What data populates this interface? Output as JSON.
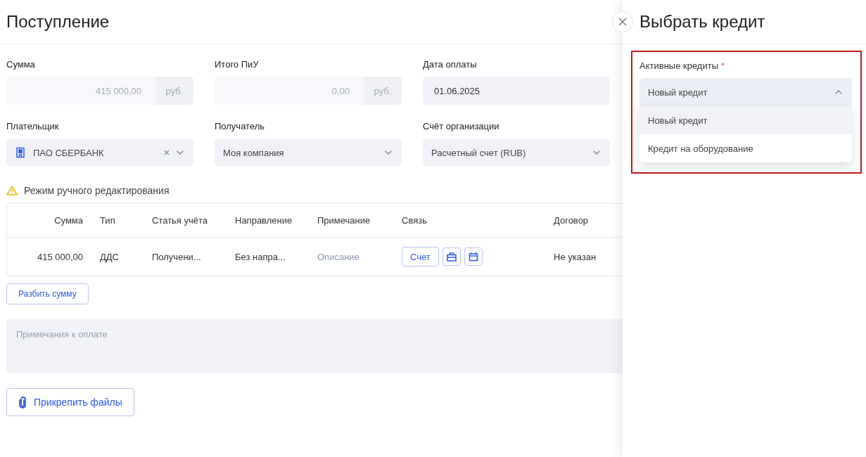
{
  "page": {
    "title": "Поступление"
  },
  "fields": [
    {
      "kind": "amount",
      "label": "Сумма",
      "value": "415 000,00",
      "unit": "руб."
    },
    {
      "kind": "amount",
      "label": "Итого ПиУ",
      "value": "0,00",
      "unit": "руб."
    },
    {
      "kind": "date",
      "label": "Дата оплаты",
      "value": "01.06.2025"
    },
    {
      "kind": "org-select",
      "label": "Плательщик",
      "value": "ПАО СБЕРБАНК"
    },
    {
      "kind": "select",
      "label": "Получатель",
      "value": "Моя компания"
    },
    {
      "kind": "select",
      "label": "Счёт организации",
      "value": "Расчетный счет (RUB)"
    }
  ],
  "warning": "Режим ручного редактирования",
  "table": {
    "columns": [
      "Сумма",
      "Тип",
      "Статья учёта",
      "Направление",
      "Примечание",
      "Связь",
      "Договор"
    ],
    "rows": [
      {
        "amount": "415 000,00",
        "type": "ДДС",
        "article": "Получени...",
        "direction": "Без напра...",
        "note": "Описание",
        "link_button": "Счет",
        "contract": "Не указан"
      }
    ]
  },
  "split_button": "Разбить сумму",
  "notes": {
    "placeholder": "Примечания к оплате"
  },
  "attach_button": "Прикрепить файлы",
  "drawer": {
    "title": "Выбрать кредит",
    "label": "Активные кредиты",
    "required_mark": "*",
    "select": {
      "value": "Новый кредит",
      "expanded": true
    },
    "options": [
      {
        "label": "Новый кредит",
        "selected": true
      },
      {
        "label": "Кредит на оборудование",
        "selected": false
      }
    ]
  }
}
